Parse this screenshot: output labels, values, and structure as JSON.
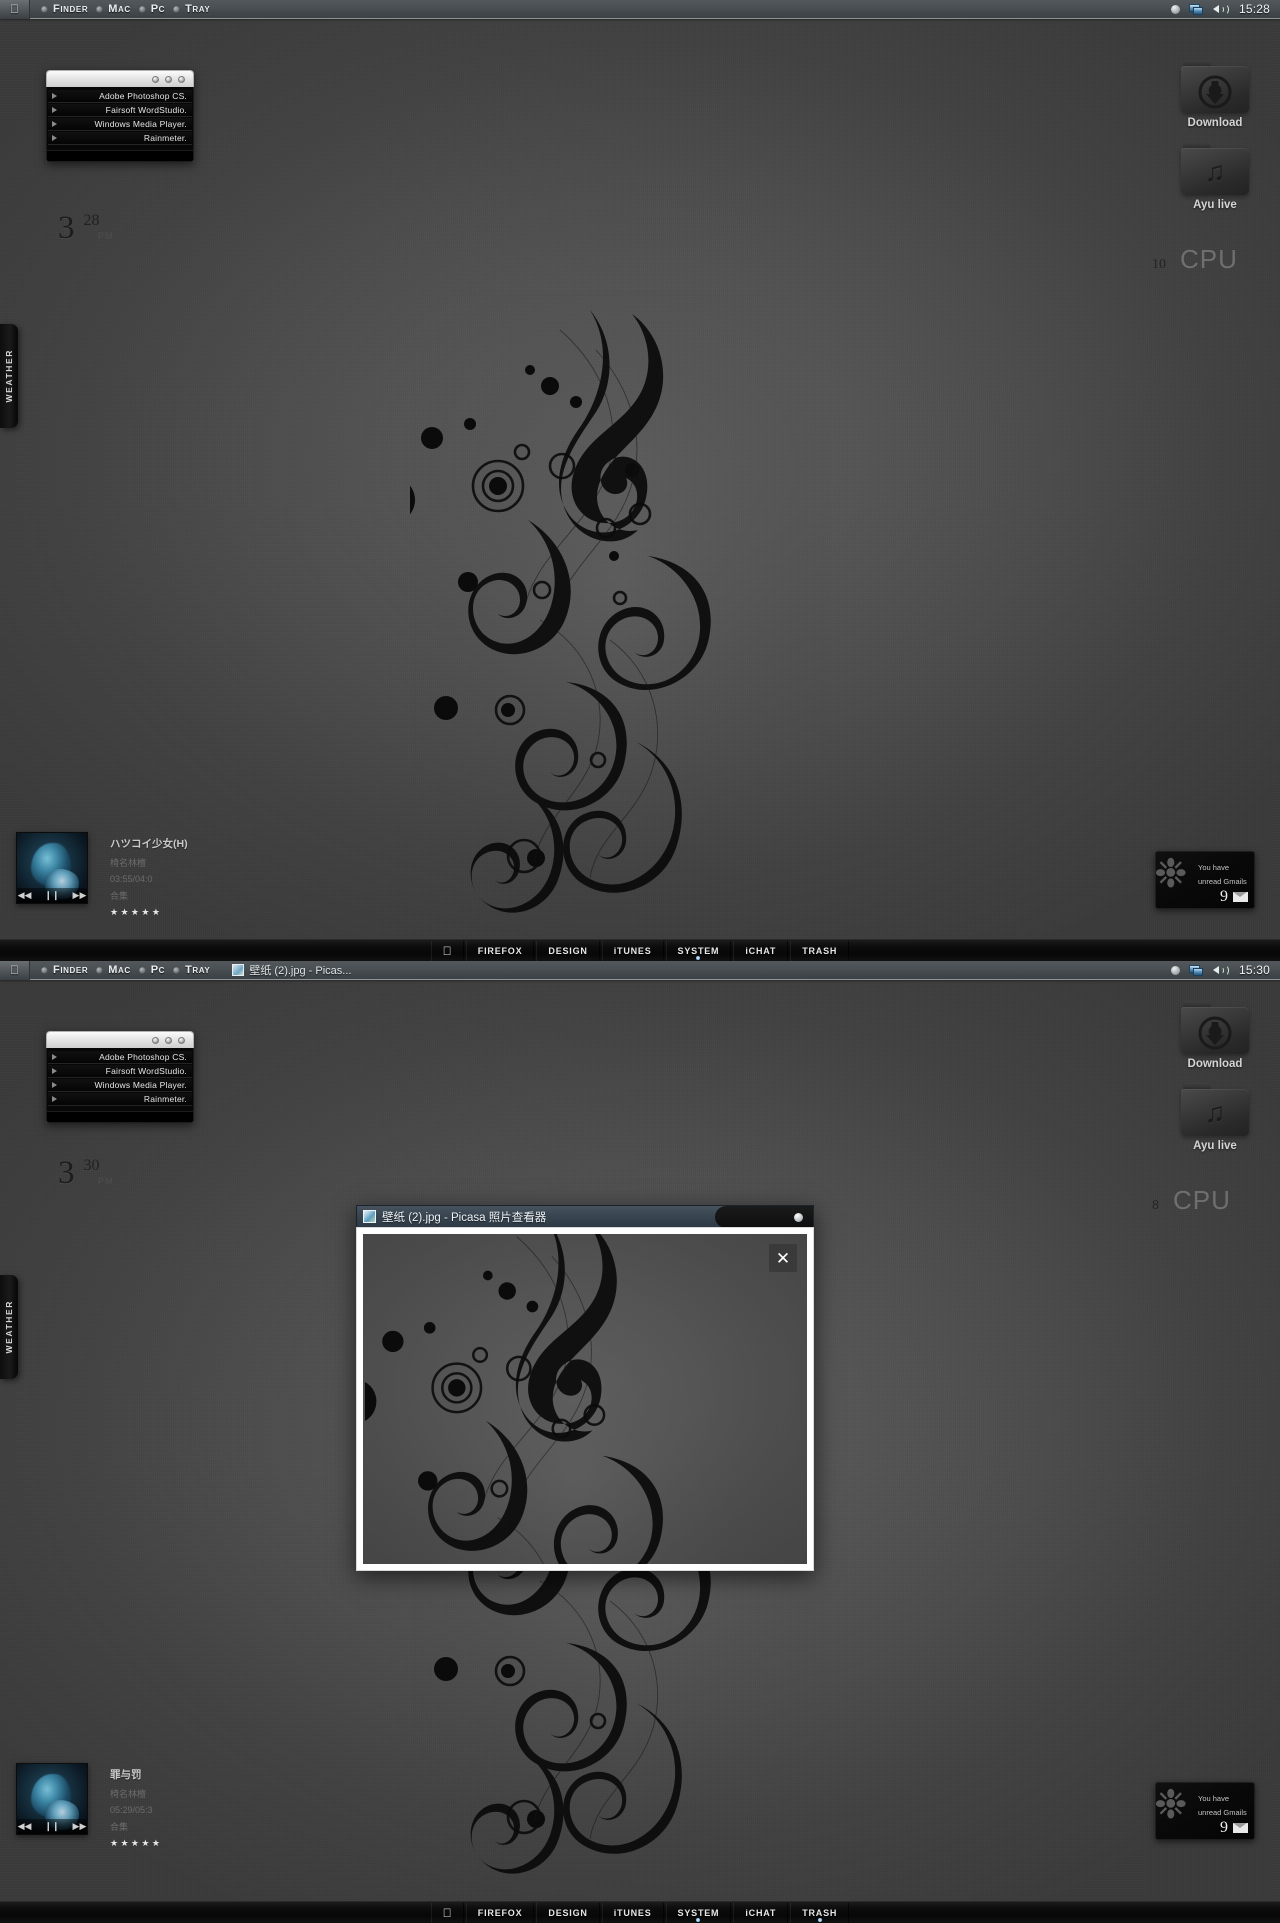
{
  "panels": [
    {
      "menubar": {
        "apple_icon": "apple-logo-icon",
        "items": [
          {
            "label": "Finder"
          },
          {
            "label": "Mac"
          },
          {
            "label": "Pc"
          },
          {
            "label": "Tray"
          }
        ],
        "task": null,
        "tray": {
          "status_dot": "status-dot-icon",
          "network_icon": "network-icon",
          "volume_icon": "volume-icon",
          "clock": "15:28"
        }
      },
      "launcher": {
        "window_dots": 3,
        "items": [
          {
            "label": "Adobe Photoshop CS."
          },
          {
            "label": "Fairsoft WordStudio."
          },
          {
            "label": "Windows Media Player."
          },
          {
            "label": "Rainmeter."
          }
        ]
      },
      "date_widget": {
        "day": "3",
        "num": "28",
        "sub": "PM"
      },
      "weather_tab": {
        "label": "Weather"
      },
      "desktop_icons": [
        {
          "name": "Download",
          "icon": "download-folder-icon",
          "glyph": "⓪"
        },
        {
          "name": "Ayu live",
          "icon": "music-folder-icon",
          "glyph": "♫"
        }
      ],
      "cpu_meter": {
        "value": "10",
        "label": "CPU"
      },
      "player": {
        "title": "ハツコイ少女(H)",
        "artist": "椅名林檀",
        "time": "03:55/04:0",
        "album": "合集",
        "rating": "★★★★★",
        "prev_icon": "prev-track-icon",
        "play_icon": "pause-icon",
        "next_icon": "next-track-icon"
      },
      "gmail": {
        "line1": "You have",
        "line2": "unread  Gmails",
        "count": "9",
        "envelope_icon": "envelope-icon"
      },
      "dock": {
        "apple_icon": "apple-logo-icon",
        "items": [
          {
            "label": "FIREFOX",
            "active": false
          },
          {
            "label": "DESIGN",
            "active": false
          },
          {
            "label": "iTUNES",
            "active": false
          },
          {
            "label": "SYSTEM",
            "active": true
          },
          {
            "label": "iCHAT",
            "active": false
          },
          {
            "label": "TRASH",
            "active": false
          }
        ]
      },
      "window": null
    },
    {
      "menubar": {
        "apple_icon": "apple-logo-icon",
        "items": [
          {
            "label": "Finder"
          },
          {
            "label": "Mac"
          },
          {
            "label": "Pc"
          },
          {
            "label": "Tray"
          }
        ],
        "task": {
          "label": "壁纸 (2).jpg - Picas...",
          "icon": "picasa-thumb-icon"
        },
        "tray": {
          "status_dot": "status-dot-icon",
          "network_icon": "network-icon",
          "volume_icon": "volume-icon",
          "clock": "15:30"
        }
      },
      "launcher": {
        "window_dots": 3,
        "items": [
          {
            "label": "Adobe Photoshop CS."
          },
          {
            "label": "Fairsoft WordStudio."
          },
          {
            "label": "Windows Media Player."
          },
          {
            "label": "Rainmeter."
          }
        ]
      },
      "date_widget": {
        "day": "3",
        "num": "30",
        "sub": "PM"
      },
      "weather_tab": {
        "label": "Weather"
      },
      "desktop_icons": [
        {
          "name": "Download",
          "icon": "download-folder-icon",
          "glyph": "⓪"
        },
        {
          "name": "Ayu live",
          "icon": "music-folder-icon",
          "glyph": "♫"
        }
      ],
      "cpu_meter": {
        "value": "8",
        "label": "CPU"
      },
      "player": {
        "title": "罪与罚",
        "artist": "椅名林檀",
        "time": "05:29/05:3",
        "album": "合集",
        "rating": "★★★★★",
        "prev_icon": "prev-track-icon",
        "play_icon": "pause-icon",
        "next_icon": "next-track-icon"
      },
      "gmail": {
        "line1": "You have",
        "line2": "unread  Gmails",
        "count": "9",
        "envelope_icon": "envelope-icon"
      },
      "dock": {
        "apple_icon": "apple-logo-icon",
        "items": [
          {
            "label": "FIREFOX",
            "active": false
          },
          {
            "label": "DESIGN",
            "active": false
          },
          {
            "label": "iTUNES",
            "active": false
          },
          {
            "label": "SYSTEM",
            "active": true
          },
          {
            "label": "iCHAT",
            "active": false
          },
          {
            "label": "TRASH",
            "active": true
          }
        ]
      },
      "window": {
        "title": "壁纸 (2).jpg - Picasa 照片查看器",
        "title_icon": "picasa-thumb-icon",
        "close_label": "✕"
      }
    }
  ],
  "colors": {
    "menubar_top": "#53585c",
    "menubar_bottom": "#3c4246",
    "desktop_light": "#5a5a5a",
    "desktop_dark": "#3a3a3a",
    "dock_bg": "#0d0d0d",
    "accent_blue": "#8fc0e8",
    "window_title": "#3a4753"
  }
}
